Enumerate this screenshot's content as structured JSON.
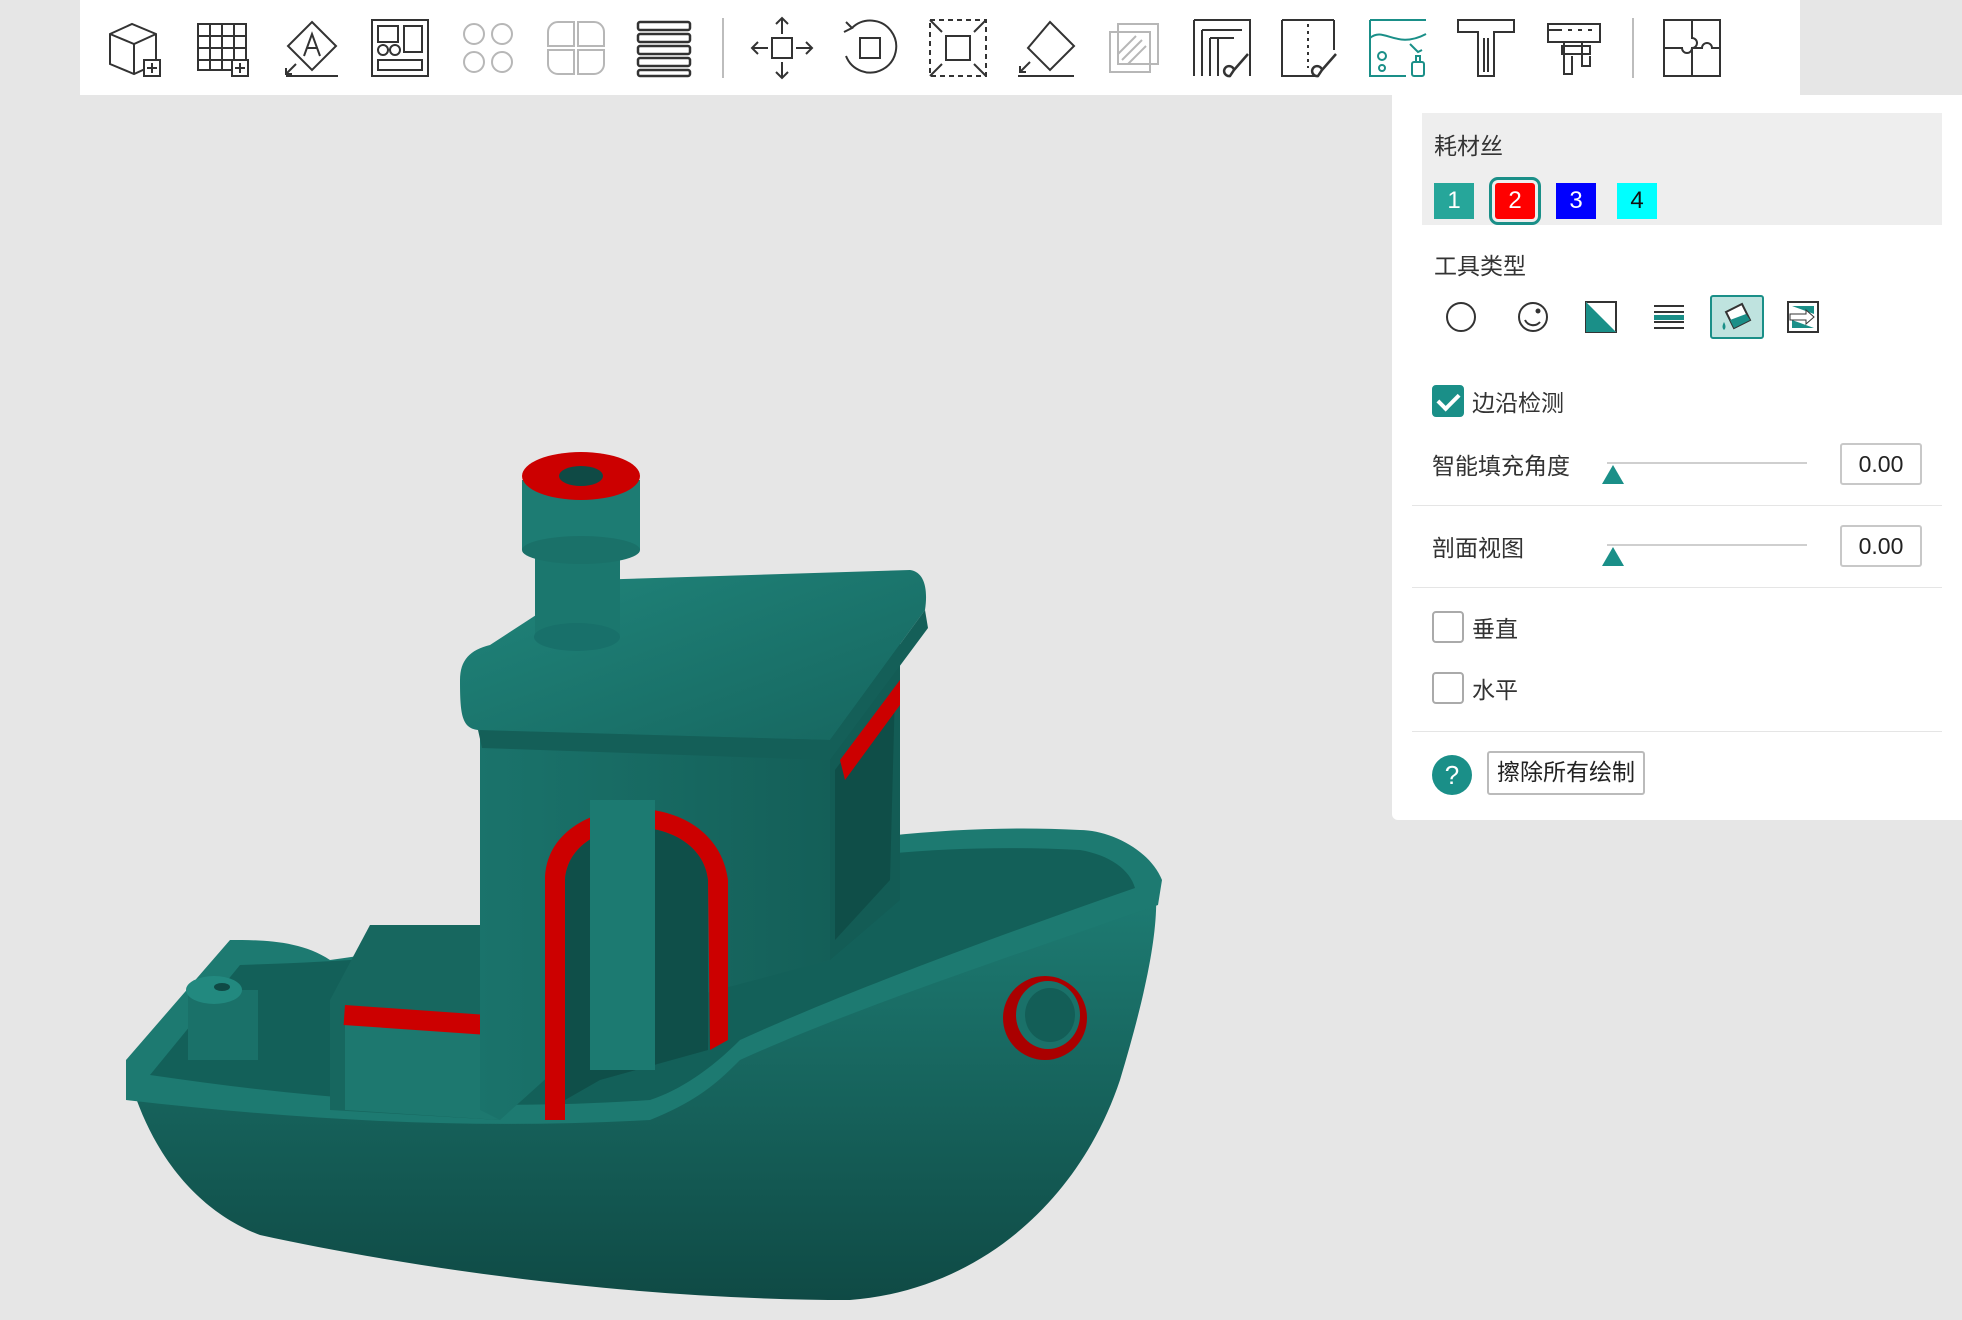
{
  "toolbar": {
    "buttons": [
      {
        "icon": "add-cube-icon",
        "enabled": true
      },
      {
        "icon": "add-plate-icon",
        "enabled": true
      },
      {
        "icon": "auto-orient-icon",
        "enabled": true
      },
      {
        "icon": "arrange-icon",
        "enabled": true
      },
      {
        "icon": "split-objects-icon",
        "enabled": false
      },
      {
        "icon": "split-parts-icon",
        "enabled": false
      },
      {
        "icon": "layers-icon",
        "enabled": true
      },
      {
        "icon": "move-icon",
        "enabled": true
      },
      {
        "icon": "rotate-icon",
        "enabled": true
      },
      {
        "icon": "scale-icon",
        "enabled": true
      },
      {
        "icon": "lay-on-face-icon",
        "enabled": true
      },
      {
        "icon": "cut-icon",
        "enabled": false
      },
      {
        "icon": "support-paint-icon",
        "enabled": true
      },
      {
        "icon": "seam-paint-icon",
        "enabled": true
      },
      {
        "icon": "color-paint-icon",
        "enabled": true
      },
      {
        "icon": "text-icon",
        "enabled": true
      },
      {
        "icon": "measure-icon",
        "enabled": true
      },
      {
        "icon": "assembly-icon",
        "enabled": true
      }
    ]
  },
  "panel": {
    "filament_title": "耗材丝",
    "filaments": [
      {
        "label": "1",
        "color": "#26a69a",
        "selected": false
      },
      {
        "label": "2",
        "color": "#ff0000",
        "selected": true
      },
      {
        "label": "3",
        "color": "#0000ff",
        "selected": false
      },
      {
        "label": "4",
        "color": "#00ffff",
        "selected": false
      }
    ],
    "tool_type_title": "工具类型",
    "tools": [
      {
        "icon": "circle-brush-icon",
        "active": false
      },
      {
        "icon": "sphere-brush-icon",
        "active": false
      },
      {
        "icon": "triangle-brush-icon",
        "active": false
      },
      {
        "icon": "height-range-icon",
        "active": false
      },
      {
        "icon": "fill-bucket-icon",
        "active": true
      },
      {
        "icon": "gap-fill-icon",
        "active": false
      }
    ],
    "edge_detection": {
      "label": "边沿检测",
      "checked": true
    },
    "smart_fill_angle": {
      "label": "智能填充角度",
      "value": "0.00"
    },
    "section_view": {
      "label": "剖面视图",
      "value": "0.00"
    },
    "vertical": {
      "label": "垂直",
      "checked": false
    },
    "horizontal": {
      "label": "水平",
      "checked": false
    },
    "help_label": "?",
    "erase_all_label": "擦除所有绘制"
  },
  "colors": {
    "accent": "#1a8f88",
    "model": "#1f7a72",
    "paint": "#cc0000"
  }
}
